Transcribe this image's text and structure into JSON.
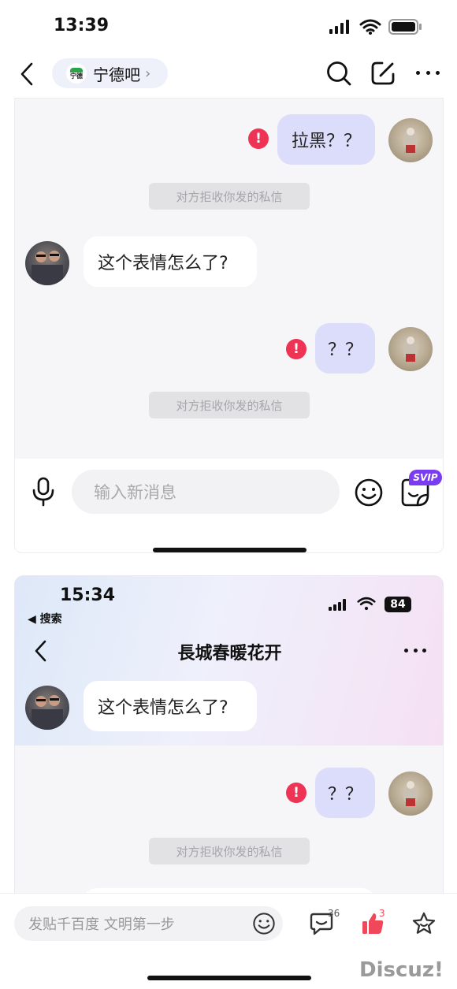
{
  "status_bar": {
    "time": "13:39"
  },
  "header": {
    "forum_name": "宁德吧",
    "forum_logo_text": "宁德"
  },
  "chat1": {
    "sent_message_1": "拉黑？？",
    "notice_1": "对方拒收你发的私信",
    "received_message": "这个表情怎么了?",
    "sent_message_2": "？？",
    "notice_2": "对方拒收你发的私信",
    "input_placeholder": "输入新消息",
    "svip_badge": "SVIP"
  },
  "chat2": {
    "time": "15:34",
    "back_app_label": "◀ 搜索",
    "battery": "84",
    "title": "長城春暖花开",
    "received_message": "这个表情怎么了?",
    "sent_message": "？？",
    "notice": "对方拒收你发的私信"
  },
  "bottom_bar": {
    "input_placeholder": "发贴千百度 文明第一步",
    "comment_count": "36",
    "like_count": "3"
  },
  "watermark": "Discuz!",
  "colors": {
    "accent_purple": "#7a3cf0",
    "error_red": "#ee3355",
    "like_red": "#f0475a"
  }
}
